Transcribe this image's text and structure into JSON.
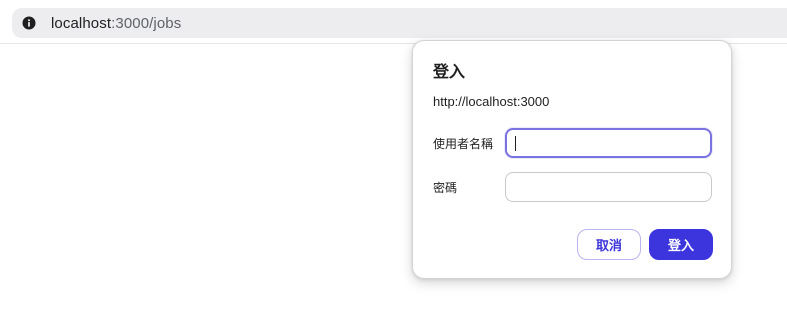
{
  "browser": {
    "url_host": "localhost",
    "url_rest": ":3000/jobs",
    "info_icon": "info-icon"
  },
  "dialog": {
    "title": "登入",
    "origin": "http://localhost:3000",
    "username_label": "使用者名稱",
    "username_value": "",
    "password_label": "密碼",
    "password_value": "",
    "cancel_label": "取消",
    "signin_label": "登入"
  },
  "colors": {
    "accent": "#3c34dd",
    "focus_ring": "#7a72e0",
    "address_bar": "#ededf0"
  }
}
